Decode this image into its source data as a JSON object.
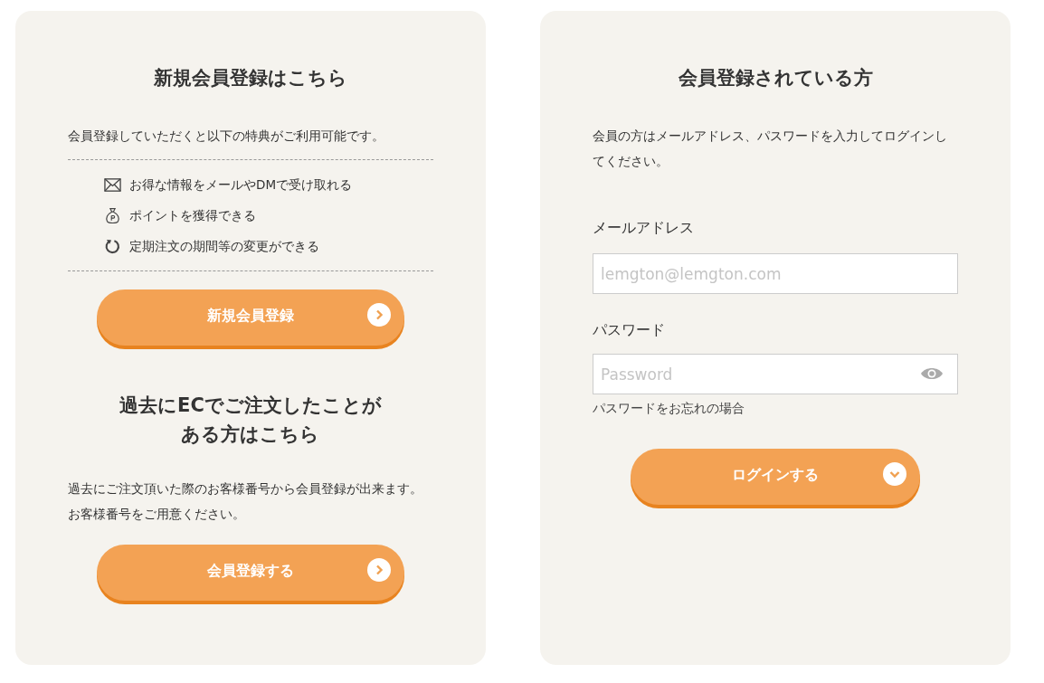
{
  "register": {
    "title": "新規会員登録はこちら",
    "description": "会員登録していただくと以下の特典がご利用可能です。",
    "benefits": [
      {
        "kind": "mail",
        "text": "お得な情報をメールやDMで受け取れる"
      },
      {
        "kind": "points",
        "text": "ポイントを獲得できる"
      },
      {
        "kind": "refresh",
        "text": "定期注文の期間等の変更ができる"
      }
    ],
    "button": {
      "label": "新規会員登録",
      "kind": "next"
    }
  },
  "past_order": {
    "title_lines": [
      "過去にECでご注文したことが",
      "ある方はこちら"
    ],
    "description": "過去にご注文頂いた際のお客様番号から会員登録が出来ます。お客様番号をご用意ください。",
    "button": {
      "label": "会員登録する",
      "kind": "next"
    }
  },
  "login": {
    "title": "会員登録されている方",
    "description": "会員の方はメールアドレス、パスワードを入力してログインしてください。",
    "email": {
      "label": "メールアドレス",
      "placeholder": "lemgton@lemgton.com"
    },
    "password": {
      "label": "パスワード",
      "placeholder": "Password"
    },
    "forgot_link": "パスワードをお忘れの場合",
    "button": {
      "label": "ログインする",
      "kind": "submit"
    }
  }
}
